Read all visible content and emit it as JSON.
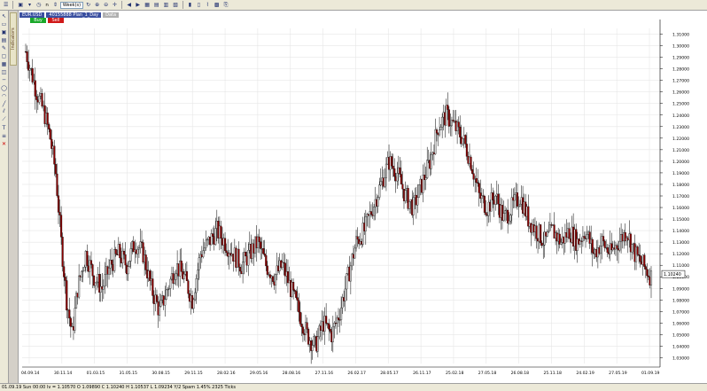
{
  "toolbar": {
    "timeframe_value": "n",
    "period_label": "Week(s)"
  },
  "chart_header": {
    "instrument": "EUR.USD",
    "account_label": "40155888 Plan_1_Day",
    "aux_label": "Data"
  },
  "orders": {
    "buy_label": "Buy",
    "sell_label": "Sell"
  },
  "sidebar": {
    "tab_label": "Indicators"
  },
  "status": {
    "text": "01.09.19 Sun 00:00 lv = 1.10570    O 1.09890  C 1.10240  H 1.10537  L 1.09234  Y/2 Spam 1.45%  2325 Ticks"
  },
  "colors": {
    "up": "#d4d4d4",
    "down": "#8b0000",
    "grid": "#e6e6e6",
    "wick": "#000000"
  },
  "chart_data": {
    "type": "candlestick",
    "title": "",
    "xlabel": "",
    "ylabel": "",
    "ylim": [
      1.025,
      1.315
    ],
    "yticks": [
      1.03,
      1.04,
      1.05,
      1.06,
      1.07,
      1.08,
      1.09,
      1.1,
      1.11,
      1.12,
      1.13,
      1.14,
      1.15,
      1.16,
      1.17,
      1.18,
      1.19,
      1.2,
      1.21,
      1.22,
      1.23,
      1.24,
      1.25,
      1.26,
      1.27,
      1.28,
      1.29,
      1.3,
      1.31
    ],
    "yticks_labels": [
      "1.03000",
      "1.04000",
      "1.05000",
      "1.06000",
      "1.07000",
      "1.08000",
      "1.09000",
      "1.10000",
      "1.11000",
      "1.12000",
      "1.13000",
      "1.14000",
      "1.15000",
      "1.16000",
      "1.17000",
      "1.18000",
      "1.19000",
      "1.20000",
      "1.21000",
      "1.22000",
      "1.23000",
      "1.24000",
      "1.25000",
      "1.26000",
      "1.27000",
      "1.28000",
      "1.29000",
      "1.30000",
      "1.31000"
    ],
    "xticks_labels": [
      "04.09.14",
      "30.11.14",
      "01.03.15",
      "31.05.15",
      "30.08.15",
      "29.11.15",
      "28.02.16",
      "29.05.16",
      "28.08.16",
      "27.11.16",
      "26.02.17",
      "28.05.17",
      "26.11.17",
      "25.02.18",
      "27.05.18",
      "26.08.18",
      "25.11.18",
      "24.02.19",
      "27.05.19",
      "01.09.19"
    ],
    "grid": true,
    "last_price": 1.1024,
    "last_price_label": "1.10240",
    "path": [
      [
        0,
        1.295
      ],
      [
        8,
        1.26
      ],
      [
        14,
        1.24
      ],
      [
        18,
        1.22
      ],
      [
        22,
        1.19
      ],
      [
        26,
        1.13
      ],
      [
        30,
        1.08
      ],
      [
        34,
        1.05
      ],
      [
        38,
        1.09
      ],
      [
        44,
        1.12
      ],
      [
        50,
        1.1
      ],
      [
        56,
        1.09
      ],
      [
        62,
        1.11
      ],
      [
        68,
        1.12
      ],
      [
        74,
        1.11
      ],
      [
        80,
        1.13
      ],
      [
        86,
        1.12
      ],
      [
        92,
        1.09
      ],
      [
        98,
        1.07
      ],
      [
        104,
        1.09
      ],
      [
        110,
        1.11
      ],
      [
        116,
        1.1
      ],
      [
        122,
        1.08
      ],
      [
        128,
        1.12
      ],
      [
        134,
        1.13
      ],
      [
        140,
        1.14
      ],
      [
        146,
        1.13
      ],
      [
        152,
        1.12
      ],
      [
        158,
        1.11
      ],
      [
        164,
        1.12
      ],
      [
        170,
        1.13
      ],
      [
        176,
        1.11
      ],
      [
        182,
        1.1
      ],
      [
        188,
        1.11
      ],
      [
        194,
        1.09
      ],
      [
        200,
        1.07
      ],
      [
        206,
        1.05
      ],
      [
        212,
        1.04
      ],
      [
        218,
        1.06
      ],
      [
        224,
        1.05
      ],
      [
        230,
        1.07
      ],
      [
        236,
        1.1
      ],
      [
        242,
        1.13
      ],
      [
        248,
        1.14
      ],
      [
        254,
        1.16
      ],
      [
        260,
        1.18
      ],
      [
        266,
        1.2
      ],
      [
        272,
        1.19
      ],
      [
        278,
        1.17
      ],
      [
        284,
        1.16
      ],
      [
        290,
        1.18
      ],
      [
        296,
        1.2
      ],
      [
        302,
        1.23
      ],
      [
        308,
        1.24
      ],
      [
        314,
        1.23
      ],
      [
        320,
        1.22
      ],
      [
        326,
        1.2
      ],
      [
        332,
        1.17
      ],
      [
        338,
        1.16
      ],
      [
        344,
        1.17
      ],
      [
        350,
        1.15
      ],
      [
        356,
        1.16
      ],
      [
        362,
        1.17
      ],
      [
        368,
        1.15
      ],
      [
        374,
        1.14
      ],
      [
        380,
        1.13
      ],
      [
        386,
        1.14
      ],
      [
        392,
        1.13
      ],
      [
        398,
        1.14
      ],
      [
        404,
        1.13
      ],
      [
        410,
        1.14
      ],
      [
        416,
        1.12
      ],
      [
        422,
        1.13
      ],
      [
        428,
        1.12
      ],
      [
        434,
        1.13
      ],
      [
        440,
        1.14
      ],
      [
        446,
        1.12
      ],
      [
        452,
        1.11
      ],
      [
        458,
        1.1
      ]
    ]
  }
}
